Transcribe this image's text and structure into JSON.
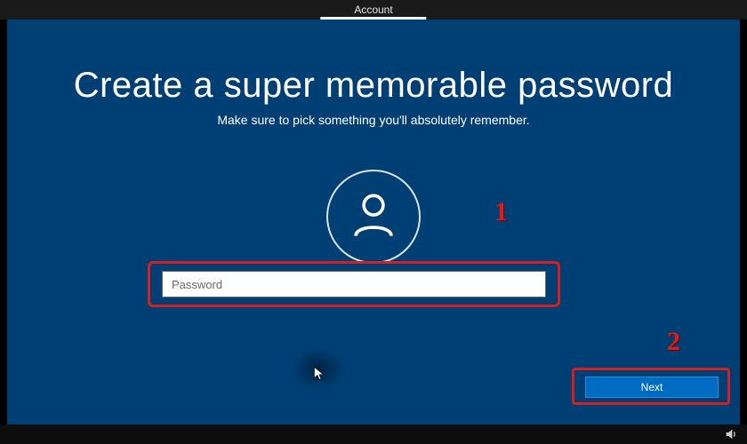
{
  "topbar": {
    "active_tab": "Account"
  },
  "header": {
    "title": "Create a super memorable password",
    "subtitle": "Make sure to pick something you'll absolutely remember."
  },
  "form": {
    "password_placeholder": "Password",
    "password_value": ""
  },
  "buttons": {
    "next": "Next"
  },
  "annotations": {
    "step1": "1",
    "step2": "2"
  },
  "icons": {
    "avatar": "user-icon",
    "cursor": "cursor-icon",
    "volume": "volume-icon"
  },
  "colors": {
    "background": "#003f73",
    "annotation": "#d61f1f",
    "button": "#006cc1"
  }
}
